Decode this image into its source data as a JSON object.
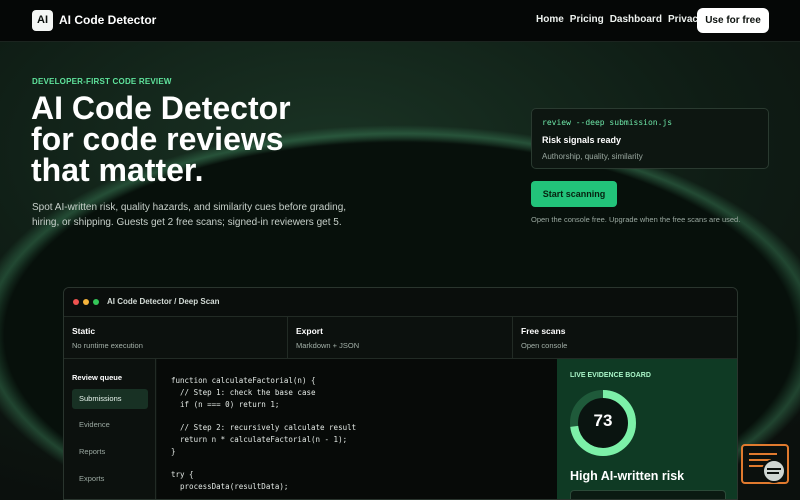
{
  "nav": {
    "logo": "AI",
    "brand": "AI Code Detector",
    "links": [
      "Home",
      "Pricing",
      "Dashboard",
      "Privacy"
    ],
    "cta": "Use for free"
  },
  "hero": {
    "eyebrow": "DEVELOPER-FIRST CODE REVIEW",
    "headline": [
      "AI Code Detector",
      "for code reviews",
      "that matter."
    ],
    "sub": "Spot AI-written risk, quality hazards, and similarity cues before grading, hiring, or shipping. Guests get 2 free scans; signed-in reviewers get 5."
  },
  "console": {
    "command": "review --deep submission.js",
    "title": "Risk signals ready",
    "sub": "Authorship, quality, similarity"
  },
  "scan": {
    "button": "Start scanning",
    "note": "Open the console free. Upgrade when the free scans are used."
  },
  "window": {
    "title": "AI Code Detector / Deep Scan",
    "dots": [
      "#ef5350",
      "#f5b43c",
      "#34c759"
    ],
    "tiles": [
      {
        "title": "Static",
        "sub": "No runtime execution"
      },
      {
        "title": "Export",
        "sub": "Markdown + JSON"
      },
      {
        "title": "Free scans",
        "sub": "Open console"
      }
    ],
    "queue": {
      "heading": "Review queue",
      "items": [
        "Submissions",
        "Evidence",
        "Reports",
        "Exports"
      ],
      "active": "Submissions"
    },
    "code": "function calculateFactorial(n) {\n  // Step 1: check the base case\n  if (n === 0) return 1;\n\n  // Step 2: recursively calculate result\n  return n * calculateFactorial(n - 1);\n}\n\ntry {\n  processData(resultData);",
    "board": {
      "heading": "LIVE EVIDENCE BOARD",
      "score": "73",
      "score_fraction": 0.73,
      "label": "High AI-written risk"
    }
  },
  "colors": {
    "accent": "#22c37a",
    "eyebrow": "#5fe39c",
    "gauge": "#7cf0a8",
    "board": "#0f3a24"
  }
}
